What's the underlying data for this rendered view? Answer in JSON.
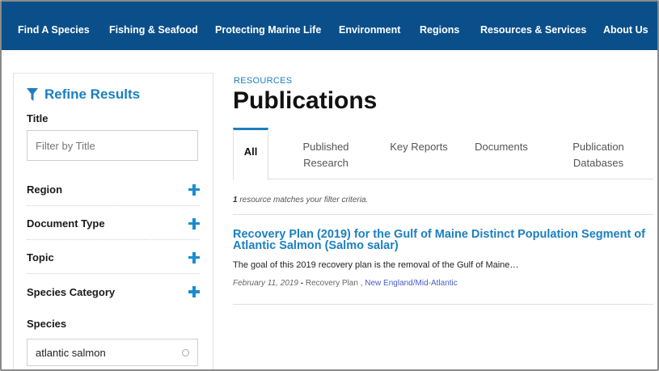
{
  "nav": {
    "items": [
      {
        "label": "Find A Species"
      },
      {
        "label": "Fishing & Seafood"
      },
      {
        "label": "Protecting Marine Life"
      },
      {
        "label": "Environment"
      },
      {
        "label": "Regions"
      },
      {
        "label": "Resources & Services"
      },
      {
        "label": "About Us"
      }
    ],
    "bg_color": "#0a4f8a"
  },
  "sidebar": {
    "heading": "Refine Results",
    "heading_icon": "filter-icon",
    "title_label": "Title",
    "title_placeholder": "Filter by Title",
    "facets": [
      {
        "label": "Region",
        "icon": "plus-icon"
      },
      {
        "label": "Document Type",
        "icon": "plus-icon"
      },
      {
        "label": "Topic",
        "icon": "plus-icon"
      },
      {
        "label": "Species Category",
        "icon": "plus-icon"
      }
    ],
    "species_label": "Species",
    "species_value": "atlantic salmon"
  },
  "main": {
    "eyebrow": "RESOURCES",
    "title": "Publications",
    "tabs": [
      {
        "label": "All",
        "active": true
      },
      {
        "label": "Published Research",
        "active": false
      },
      {
        "label": "Key Reports",
        "active": false
      },
      {
        "label": "Documents",
        "active": false
      },
      {
        "label": "Publication Databases",
        "active": false
      }
    ],
    "match_count": "1",
    "match_text": "resource matches your filter criteria.",
    "result": {
      "title": "Recovery Plan (2019) for the Gulf of Maine Distinct Population Segment of Atlantic Salmon (Salmo salar)",
      "description": "The goal of this 2019 recovery plan is the removal of the Gulf of Maine…",
      "date": "February 11, 2019",
      "separator": "-",
      "type": "Recovery Plan",
      "comma": ",",
      "region": "New England/Mid-Atlantic"
    }
  },
  "colors": {
    "accent": "#1b7fc0",
    "link": "#4a5cc2"
  }
}
